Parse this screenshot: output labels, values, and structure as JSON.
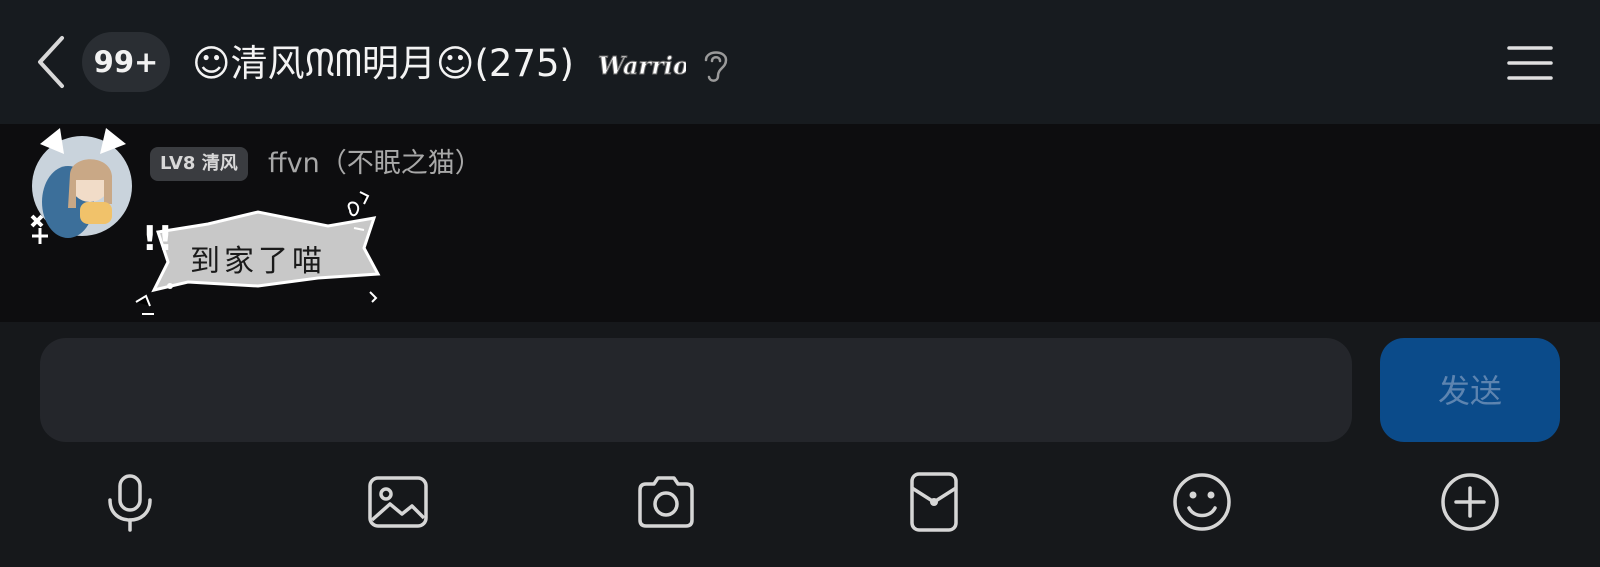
{
  "header": {
    "unread_count": "99+",
    "title": "☺清风ᙏᗰ明月☺(275)",
    "title_badge": "Warrior",
    "back_icon": "chevron-left-icon",
    "ear_icon": "ear-icon",
    "menu_icon": "hamburger-menu-icon"
  },
  "chat": {
    "messages": [
      {
        "level": "LV8 清风",
        "sender": "ffvn（不眠之猫）",
        "sticker_text": "到家了喵"
      }
    ]
  },
  "composer": {
    "input_value": "",
    "input_placeholder": "",
    "send_label": "发送",
    "tools": [
      {
        "icon": "microphone-icon"
      },
      {
        "icon": "image-icon"
      },
      {
        "icon": "camera-icon"
      },
      {
        "icon": "red-packet-icon"
      },
      {
        "icon": "emoji-icon"
      },
      {
        "icon": "plus-circle-icon"
      }
    ]
  },
  "colors": {
    "header_bg": "#171b1f",
    "chat_bg": "#0d0d0f",
    "input_bg": "#24262b",
    "send_bg": "#0b4b8a",
    "send_text": "#5d84b0"
  }
}
